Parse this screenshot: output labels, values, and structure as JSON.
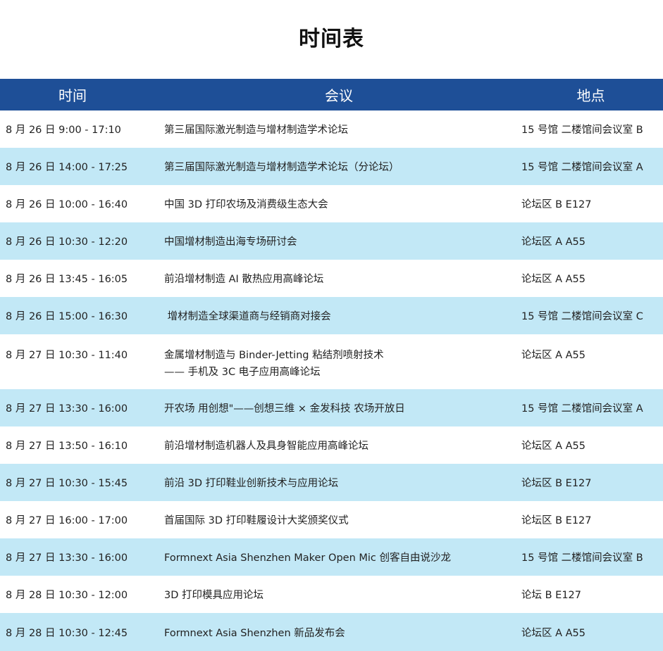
{
  "title": "时间表",
  "headers": {
    "time": "时间",
    "meeting": "会议",
    "place": "地点"
  },
  "rows": [
    {
      "time": "8 月 26 日 9:00 - 17:10",
      "meeting": [
        "第三届国际激光制造与增材制造学术论坛"
      ],
      "place": "15 号馆 二楼馆间会议室 B"
    },
    {
      "time": "8 月 26 日 14:00 - 17:25",
      "meeting": [
        "第三届国际激光制造与增材制造学术论坛（分论坛）"
      ],
      "place": "15 号馆 二楼馆间会议室 A"
    },
    {
      "time": "8 月 26 日 10:00 - 16:40",
      "meeting": [
        "中国 3D 打印农场及消费级生态大会"
      ],
      "place": "论坛区 B E127"
    },
    {
      "time": "8 月 26 日 10:30 - 12:20",
      "meeting": [
        "中国增材制造出海专场研讨会"
      ],
      "place": "论坛区 A A55"
    },
    {
      "time": "8 月 26 日 13:45 - 16:05",
      "meeting": [
        "前沿增材制造 AI 散热应用高峰论坛"
      ],
      "place": "论坛区 A A55"
    },
    {
      "time": "8 月 26 日 15:00 - 16:30",
      "meeting": [
        " 增材制造全球渠道商与经销商对接会"
      ],
      "place": "15 号馆 二楼馆间会议室 C"
    },
    {
      "time": "8 月 27 日 10:30 - 11:40",
      "meeting": [
        "金属增材制造与 Binder-Jetting 粘结剂喷射技术",
        "—— 手机及 3C 电子应用高峰论坛"
      ],
      "place": "论坛区 A A55"
    },
    {
      "time": "8 月 27 日 13:30 - 16:00",
      "meeting": [
        "开农场 用创想\"——创想三维 × 金发科技 农场开放日"
      ],
      "place": "15 号馆 二楼馆间会议室 A"
    },
    {
      "time": "8 月 27 日 13:50 - 16:10",
      "meeting": [
        "前沿增材制造机器人及具身智能应用高峰论坛"
      ],
      "place": "论坛区 A A55"
    },
    {
      "time": "8 月 27 日 10:30 - 15:45",
      "meeting": [
        "前沿 3D 打印鞋业创新技术与应用论坛"
      ],
      "place": "论坛区 B E127"
    },
    {
      "time": "8 月 27 日 16:00 - 17:00",
      "meeting": [
        "首届国际 3D 打印鞋履设计大奖颁奖仪式"
      ],
      "place": "论坛区 B E127"
    },
    {
      "time": "8 月 27 日 13:30 - 16:00",
      "meeting": [
        "Formnext Asia Shenzhen Maker Open Mic 创客自由说沙龙"
      ],
      "place": "15 号馆 二楼馆间会议室 B"
    },
    {
      "time": "8 月 28 日 10:30 - 12:00",
      "meeting": [
        "3D 打印模具应用论坛"
      ],
      "place": "论坛 B E127"
    },
    {
      "time": "8 月 28 日 10:30 - 12:45",
      "meeting": [
        "Formnext Asia Shenzhen 新品发布会"
      ],
      "place": "论坛区 A A55"
    }
  ],
  "colors": {
    "header_bg": "#1e4f97",
    "alt_row_bg": "#c2e8f6"
  }
}
